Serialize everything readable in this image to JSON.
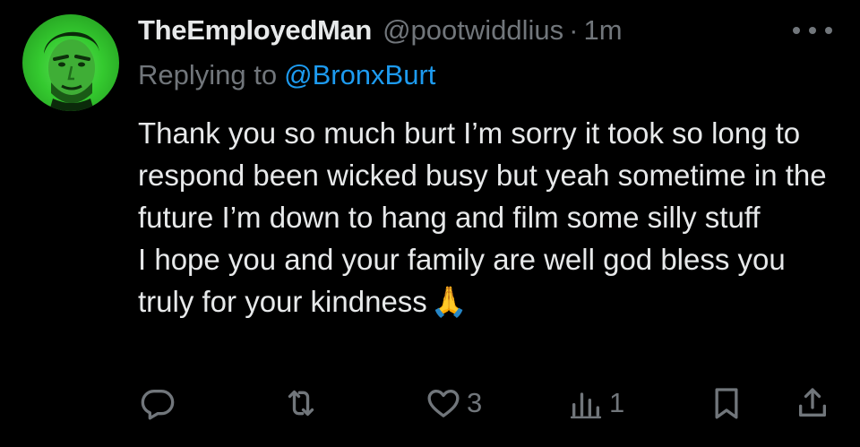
{
  "author": {
    "display_name": "TheEmployedMan",
    "handle": "@pootwiddlius",
    "separator": "·",
    "time": "1m"
  },
  "reply": {
    "prefix": "Replying to",
    "mention": "@BronxBurt"
  },
  "body": {
    "paragraph1": "Thank you so much burt I’m sorry it took so long to respond been wicked busy but yeah sometime in the future I’m down to hang and film some silly stuff",
    "paragraph2": "I hope you and your family are well god bless you truly for your kindness",
    "emoji": "🙏"
  },
  "actions": {
    "reply_count": "",
    "repost_count": "",
    "like_count": "3",
    "views_count": "1"
  },
  "icons": {
    "more": "more-dots-icon",
    "reply": "reply-bubble-icon",
    "repost": "repost-arrows-icon",
    "like": "heart-icon",
    "views": "views-bars-icon",
    "bookmark": "bookmark-icon",
    "share": "share-icon"
  },
  "colors": {
    "background": "#000000",
    "text": "#e7e9ea",
    "muted": "#71767b",
    "accent": "#1d9bf0",
    "avatar_bg": "#34c92f"
  }
}
